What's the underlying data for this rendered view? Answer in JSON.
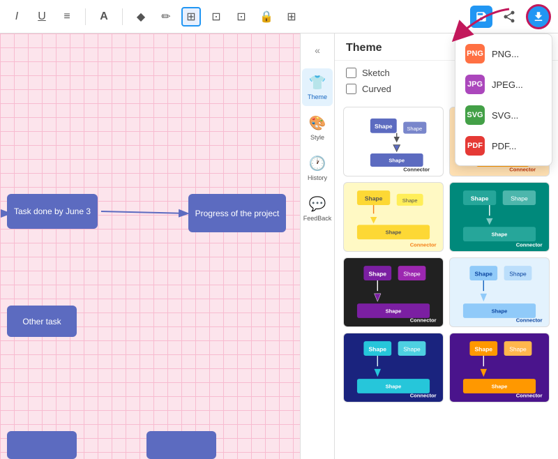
{
  "toolbar": {
    "icons": [
      "I",
      "U",
      "≡",
      "A",
      "✦",
      "✏",
      "⬛",
      "⊡",
      "⊞",
      "🔒",
      "⊞"
    ],
    "save_label": "💾",
    "share_label": "↗",
    "export_label": "📤"
  },
  "canvas": {
    "shapes": [
      {
        "id": "task-done",
        "label": "Task done by June 3"
      },
      {
        "id": "progress",
        "label": "Progress of the project"
      },
      {
        "id": "other-task",
        "label": "Other task"
      }
    ]
  },
  "sidebar": {
    "collapse_label": "«",
    "items": [
      {
        "id": "theme",
        "label": "Theme",
        "icon": "👕"
      },
      {
        "id": "style",
        "label": "Style",
        "icon": "🎨"
      },
      {
        "id": "history",
        "label": "History",
        "icon": "🕐"
      },
      {
        "id": "feedback",
        "label": "FeedBack",
        "icon": "💬"
      }
    ]
  },
  "panel": {
    "title": "Theme",
    "options": [
      {
        "id": "sketch",
        "label": "Sketch",
        "checked": false
      },
      {
        "id": "curved",
        "label": "Curved",
        "checked": false
      }
    ],
    "themes": [
      {
        "id": "default",
        "bg": "#ffffff",
        "shapes": [
          "#5c6bc0",
          "#5c6bc0",
          "#5c6bc0"
        ],
        "label": "Connector",
        "labelColor": "#333"
      },
      {
        "id": "orange",
        "bg": "#ffe0b2",
        "shapes": [
          "#ff9800",
          "#ff9800",
          "#ff9800"
        ],
        "label": "Connector",
        "labelColor": "#bf360c"
      },
      {
        "id": "yellow",
        "bg": "#fff9c4",
        "shapes": [
          "#fdd835",
          "#fdd835",
          "#fdd835"
        ],
        "label": "Connector",
        "labelColor": "#f57f17"
      },
      {
        "id": "teal",
        "bg": "#00897b",
        "shapes": [
          "#26a69a",
          "#26a69a",
          "#26a69a"
        ],
        "label": "Connector",
        "labelColor": "white"
      },
      {
        "id": "dark",
        "bg": "#212121",
        "shapes": [
          "#7b1fa2",
          "#7b1fa2",
          "#7b1fa2"
        ],
        "label": "Connector",
        "labelColor": "white"
      },
      {
        "id": "light-blue",
        "bg": "#e3f2fd",
        "shapes": [
          "#90caf9",
          "#90caf9",
          "#90caf9"
        ],
        "label": "Connector",
        "labelColor": "#0d47a1"
      },
      {
        "id": "navy",
        "bg": "#1a237e",
        "shapes": [
          "#26c6da",
          "#26c6da",
          "#26c6da"
        ],
        "label": "Connector",
        "labelColor": "white"
      },
      {
        "id": "purple",
        "bg": "#4a148c",
        "shapes": [
          "#ff9800",
          "#ff9800",
          "#ff9800"
        ],
        "label": "Connector",
        "labelColor": "white"
      }
    ]
  },
  "export": {
    "items": [
      {
        "id": "png",
        "label": "PNG...",
        "bg": "#ff7043",
        "icon": "PNG"
      },
      {
        "id": "jpeg",
        "label": "JPEG...",
        "bg": "#ab47bc",
        "icon": "JPG"
      },
      {
        "id": "svg",
        "label": "SVG...",
        "bg": "#43a047",
        "icon": "SVG"
      },
      {
        "id": "pdf",
        "label": "PDF...",
        "bg": "#e53935",
        "icon": "PDF"
      }
    ]
  }
}
